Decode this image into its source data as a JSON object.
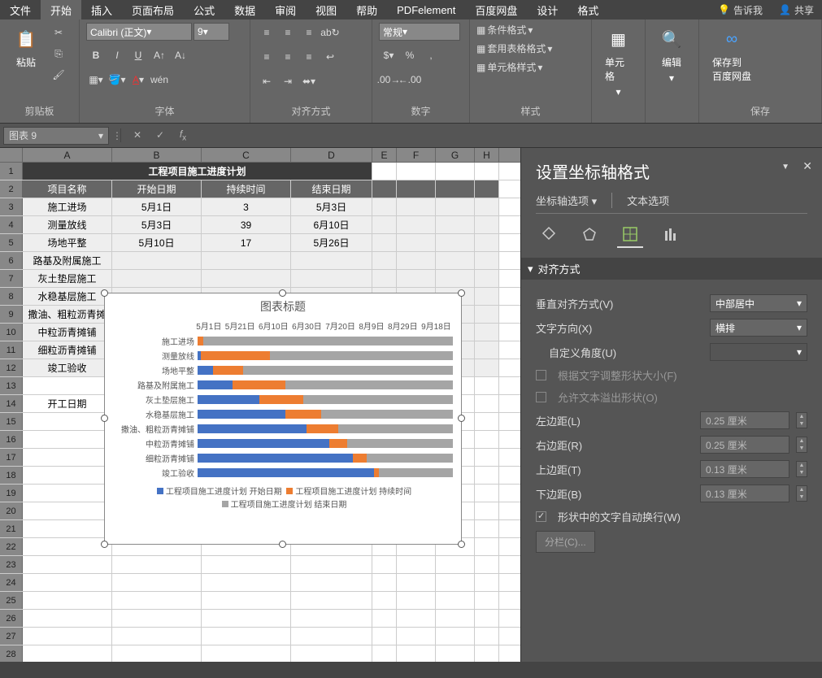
{
  "menu": {
    "tabs": [
      "文件",
      "开始",
      "插入",
      "页面布局",
      "公式",
      "数据",
      "审阅",
      "视图",
      "帮助",
      "PDFelement",
      "百度网盘",
      "设计",
      "格式"
    ],
    "active": 1,
    "tell": "告诉我",
    "share": "共享"
  },
  "ribbon": {
    "clipboard": {
      "label": "剪贴板",
      "paste": "粘贴"
    },
    "font": {
      "label": "字体",
      "name": "Calibri (正文)",
      "size": "9"
    },
    "align": {
      "label": "对齐方式"
    },
    "number": {
      "label": "数字",
      "style": "常规"
    },
    "styles": {
      "label": "样式",
      "cond": "条件格式",
      "table": "套用表格格式",
      "cell": "单元格样式"
    },
    "cells": {
      "label": "单元格"
    },
    "editing": {
      "label": "编辑"
    },
    "baidu": {
      "label": "保存",
      "btn": "保存到\n百度网盘"
    }
  },
  "namebox": "图表 9",
  "table": {
    "title": "工程项目施工进度计划",
    "headers": [
      "项目名称",
      "开始日期",
      "持续时间",
      "结束日期"
    ],
    "rows": [
      [
        "施工进场",
        "5月1日",
        "3",
        "5月3日"
      ],
      [
        "测量放线",
        "5月3日",
        "39",
        "6月10日"
      ],
      [
        "场地平整",
        "5月10日",
        "17",
        "5月26日"
      ],
      [
        "路基及附属施工",
        "",
        "",
        ""
      ],
      [
        "灰土垫层施工",
        "",
        "",
        ""
      ],
      [
        "水稳基层施工",
        "",
        "",
        ""
      ],
      [
        "撒油、粗粒沥青摊",
        "",
        "",
        ""
      ],
      [
        "中粒沥青摊铺",
        "",
        "",
        ""
      ],
      [
        "细粒沥青摊铺",
        "",
        "",
        ""
      ],
      [
        "竣工验收",
        "",
        "",
        ""
      ]
    ],
    "extra": "开工日期"
  },
  "chart_data": {
    "type": "bar",
    "title": "图表标题",
    "x_ticks": [
      "5月1日",
      "5月21日",
      "6月10日",
      "6月30日",
      "7月20日",
      "8月9日",
      "8月29日",
      "9月18日"
    ],
    "categories": [
      "施工进场",
      "测量放线",
      "场地平整",
      "路基及附属施工",
      "灰土垫层施工",
      "水稳基层施工",
      "撒油、粗粒沥青摊铺",
      "中粒沥青摊铺",
      "细粒沥青摊铺",
      "竣工验收"
    ],
    "series": [
      {
        "name": "工程项目施工进度计划 开始日期",
        "color": "#4472c4",
        "values": [
          0,
          2,
          9,
          20,
          35,
          50,
          62,
          75,
          88,
          100
        ]
      },
      {
        "name": "工程项目施工进度计划 持续时间",
        "color": "#ed7d31",
        "values": [
          3,
          39,
          17,
          30,
          25,
          20,
          18,
          10,
          8,
          3
        ]
      },
      {
        "name": "工程项目施工进度计划 结束日期",
        "color": "#a5a5a5",
        "values": [
          140,
          140,
          140,
          140,
          140,
          140,
          140,
          140,
          140,
          140
        ]
      }
    ],
    "legend": [
      "工程项目施工进度计划 开始日期",
      "工程项目施工进度计划 持续时间",
      "工程项目施工进度计划 结束日期"
    ]
  },
  "pane": {
    "title": "设置坐标轴格式",
    "tab1": "坐标轴选项",
    "tab2": "文本选项",
    "section": "对齐方式",
    "valign_label": "垂直对齐方式(V)",
    "valign_value": "中部居中",
    "dir_label": "文字方向(X)",
    "dir_value": "横排",
    "angle_label": "自定义角度(U)",
    "cb_resize": "根据文字调整形状大小(F)",
    "cb_overflow": "允许文本溢出形状(O)",
    "left_label": "左边距(L)",
    "left_val": "0.25 厘米",
    "right_label": "右边距(R)",
    "right_val": "0.25 厘米",
    "top_label": "上边距(T)",
    "top_val": "0.13 厘米",
    "bottom_label": "下边距(B)",
    "bottom_val": "0.13 厘米",
    "cb_wrap": "形状中的文字自动换行(W)",
    "columns_btn": "分栏(C)..."
  }
}
